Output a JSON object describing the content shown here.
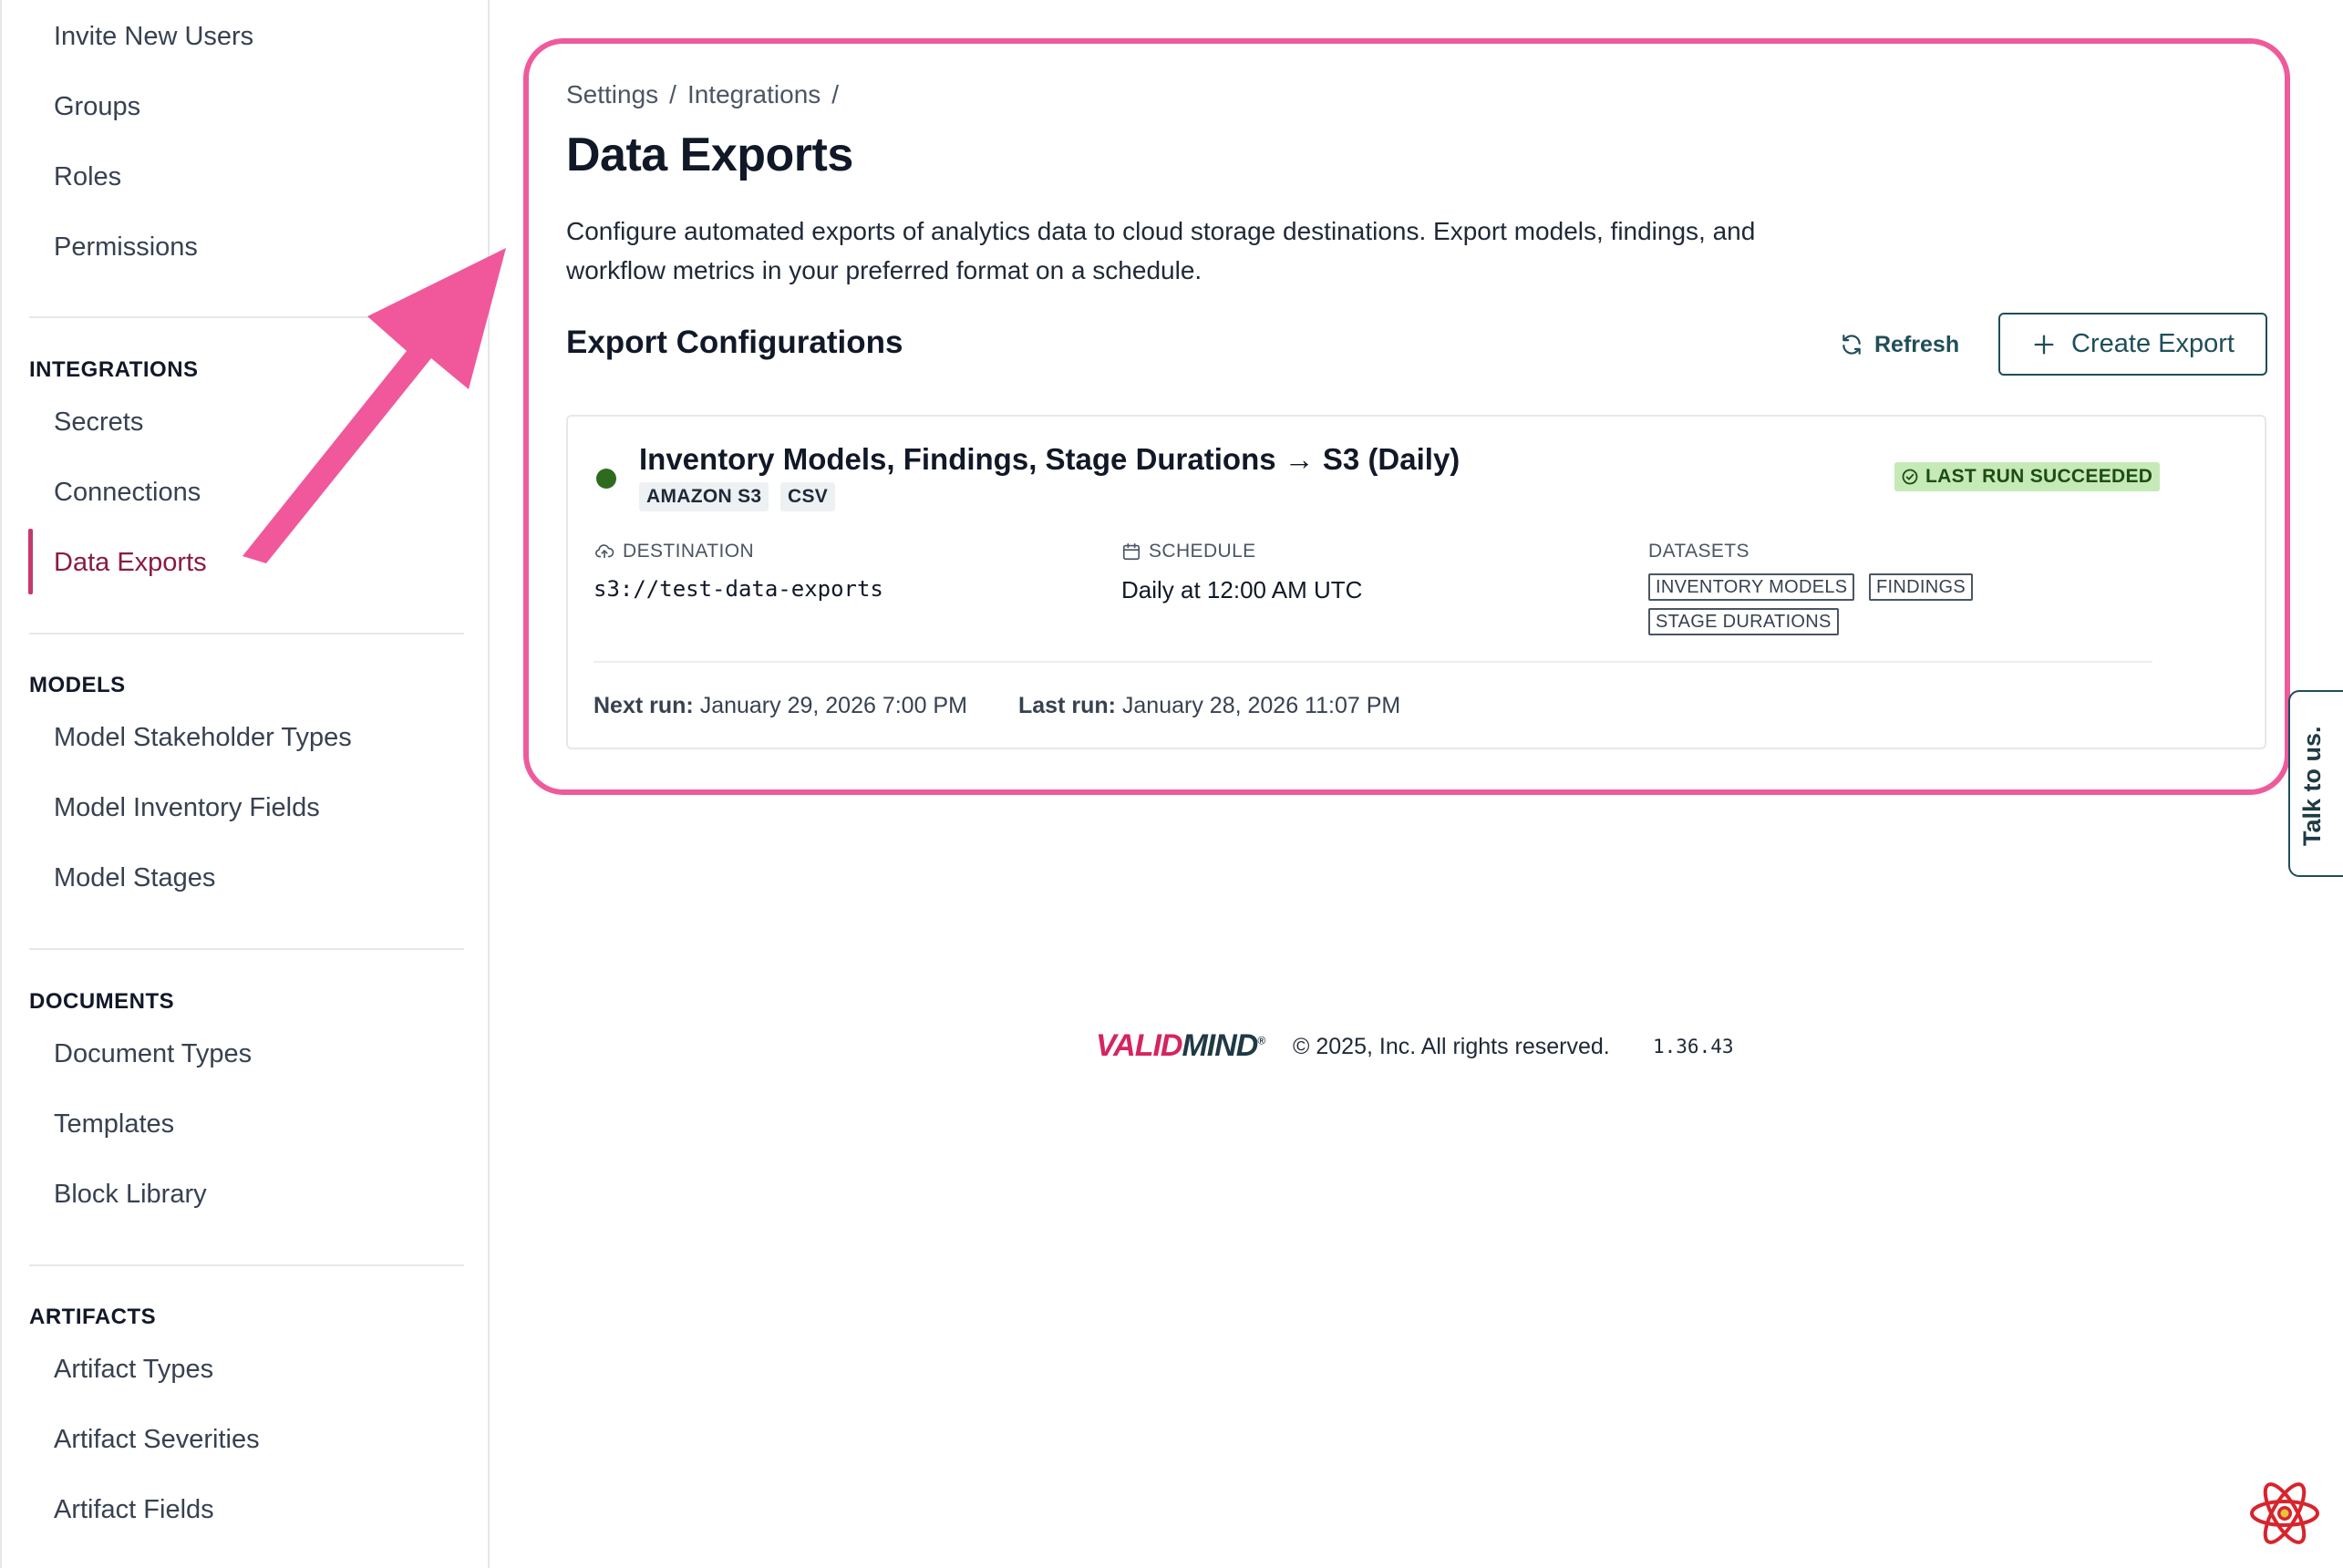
{
  "sidebar": {
    "top_items": [
      "Invite New Users",
      "Groups",
      "Roles",
      "Permissions"
    ],
    "sections": [
      {
        "heading": "INTEGRATIONS",
        "items": [
          "Secrets",
          "Connections",
          "Data Exports"
        ]
      },
      {
        "heading": "MODELS",
        "items": [
          "Model Stakeholder Types",
          "Model Inventory Fields",
          "Model Stages"
        ]
      },
      {
        "heading": "DOCUMENTS",
        "items": [
          "Document Types",
          "Templates",
          "Block Library"
        ]
      },
      {
        "heading": "ARTIFACTS",
        "items": [
          "Artifact Types",
          "Artifact Severities",
          "Artifact Fields"
        ]
      }
    ],
    "active_item": "Data Exports"
  },
  "breadcrumb": {
    "items": [
      "Settings",
      "Integrations"
    ],
    "separator": "/"
  },
  "page": {
    "title": "Data Exports",
    "description": "Configure automated exports of analytics data to cloud storage destinations. Export models, findings, and workflow metrics in your preferred format on a schedule."
  },
  "exports_section": {
    "title": "Export Configurations",
    "refresh_label": "Refresh",
    "create_label": "Create Export"
  },
  "export_card": {
    "title": "Inventory Models, Findings, Stage Durations → S3 (Daily)",
    "tags": [
      "AMAZON S3",
      "CSV"
    ],
    "status": "LAST RUN SUCCEEDED",
    "destination_label": "DESTINATION",
    "destination_value": "s3://test-data-exports",
    "schedule_label": "SCHEDULE",
    "schedule_value": "Daily at 12:00 AM UTC",
    "datasets_label": "DATASETS",
    "datasets": [
      "INVENTORY MODELS",
      "FINDINGS",
      "STAGE DURATIONS"
    ],
    "next_run_label": "Next run:",
    "next_run_value": "January 29, 2026 7:00 PM",
    "last_run_label": "Last run:",
    "last_run_value": "January 28, 2026 11:07 PM"
  },
  "footer": {
    "logo_part1": "VALID",
    "logo_part2": "MIND",
    "logo_reg": "®",
    "copyright": "© 2025, Inc. All rights reserved.",
    "version": "1.36.43"
  },
  "talk_tab": {
    "label": "Talk to us."
  },
  "colors": {
    "accent_pink": "#ee5a9c",
    "active_nav": "#8a1b43",
    "primary_teal": "#1f4e5a",
    "success_bg": "#c6e9b8",
    "status_dot": "#2e6b1f"
  },
  "icons": {
    "refresh": "refresh-icon",
    "create": "plus-icon",
    "status_check": "check-circle-icon",
    "destination": "cloud-upload-icon",
    "schedule": "calendar-icon",
    "annotation": "arrow-icon",
    "devtools": "react-icon"
  }
}
